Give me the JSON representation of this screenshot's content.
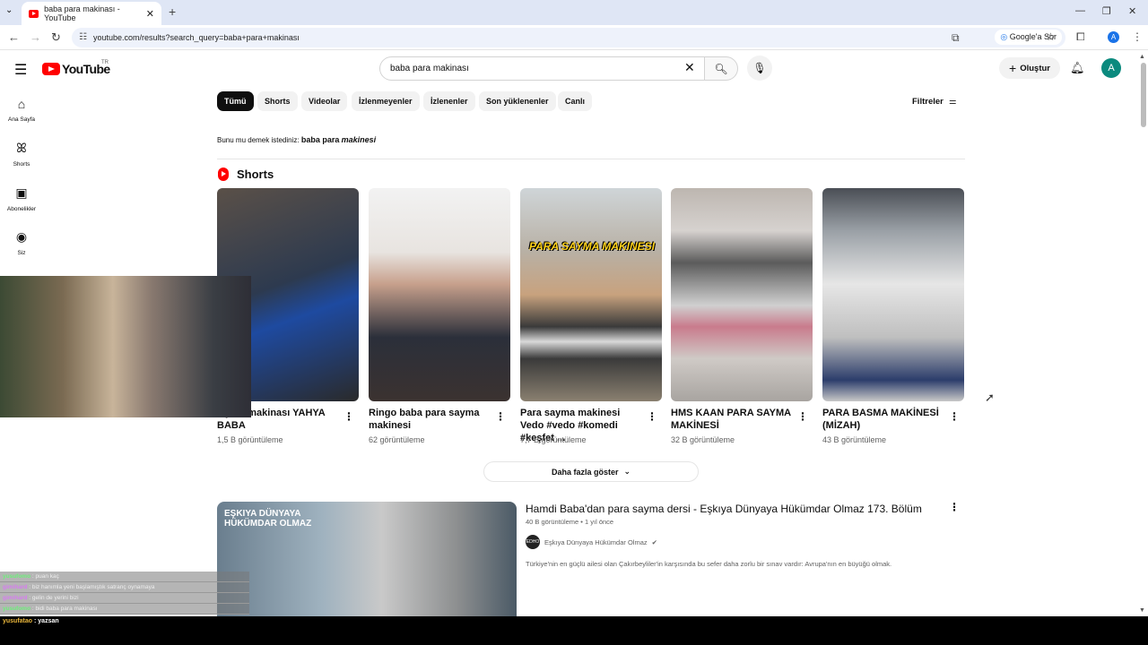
{
  "browser": {
    "tab_title": "baba para makinası - YouTube",
    "url": "youtube.com/results?search_query=baba+para+makinası",
    "google_ask": "Google'a Sor",
    "profile_initial": "A"
  },
  "header": {
    "logo_text": "YouTube",
    "country_code": "TR",
    "search_value": "baba para makinası",
    "create_label": "Oluştur",
    "avatar_initial": "A"
  },
  "sidebar": {
    "items": [
      {
        "label": "Ana Sayfa",
        "icon": "home-icon"
      },
      {
        "label": "Shorts",
        "icon": "shorts-icon"
      },
      {
        "label": "Abonelikler",
        "icon": "subscriptions-icon"
      },
      {
        "label": "Siz",
        "icon": "you-icon"
      }
    ]
  },
  "chips": [
    "Tümü",
    "Shorts",
    "Videolar",
    "İzlenmeyenler",
    "İzlenenler",
    "Son yüklenenler",
    "Canlı"
  ],
  "filters_label": "Filtreler",
  "suggestion": {
    "prefix": "Bunu mu demek istediniz:",
    "plain": "baba para",
    "italic": "makinesi"
  },
  "shorts_section": {
    "title": "Shorts",
    "items": [
      {
        "title": "Para sayma makinası YAHYA BABA",
        "visible_title": "...yma makinası YAHYA BABA",
        "views": "1,5 B görüntüleme"
      },
      {
        "title": "Ringo baba para sayma makinesi",
        "views": "62 görüntüleme"
      },
      {
        "title": "Para sayma makinesi Vedo #vedo #komedi #keşfet ...",
        "views": "7,7 B görüntüleme",
        "overlay_text": "PARA SAYMA MAKINESI"
      },
      {
        "title": "HMS KAAN PARA SAYMA MAKİNESİ",
        "views": "32 B görüntüleme"
      },
      {
        "title": "PARA BASMA MAKİNESİ (MİZAH)",
        "views": "43 B görüntüleme"
      }
    ],
    "show_more": "Daha fazla göster"
  },
  "video": {
    "title": "Hamdi Baba'dan para sayma dersi - Eşkıya Dünyaya Hükümdar Olmaz 173. Bölüm",
    "meta": "40 B görüntüleme • 1 yıl önce",
    "channel": "Eşkıya Dünyaya Hükümdar Olmaz",
    "channel_avatar_text": "EDHO",
    "description": "Türkiye'nin en güçlü ailesi olan Çakırbeyliler'in karşısında bu sefer daha zorlu bir sınav vardır: Avrupa'nın en büyüğü olmak.",
    "thumb_text": "EŞKIYA DÜNYAYA HÜKÜMDAR OLMAZ"
  },
  "stream_chat": {
    "lines": [
      {
        "user": "yusufomo",
        "text": "puan kaç"
      },
      {
        "user": "gimihard",
        "text": "biz hanımla yeni başlamıştık satranç oynamaya"
      },
      {
        "user": "gimihard",
        "text": "gelin de yerini bizi"
      },
      {
        "user": "yusufomo",
        "text": "bidi baba para makinası"
      }
    ],
    "bottom": {
      "user": "yusufatao",
      "text": ": yazsan"
    }
  },
  "colors": {
    "brand_red": "#ff0000",
    "chip_active": "#0f0f0f",
    "avatar": "#0b8a7e"
  }
}
